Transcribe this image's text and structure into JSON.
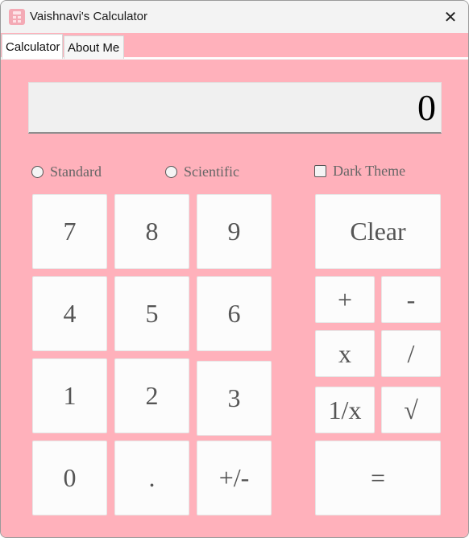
{
  "window": {
    "title": "Vaishnavi's Calculator",
    "close_glyph": "✕"
  },
  "tabs": [
    {
      "label": "Calculator",
      "active": true
    },
    {
      "label": "About Me",
      "active": false
    }
  ],
  "display": {
    "value": "0"
  },
  "options": {
    "standard_label": "Standard",
    "scientific_label": "Scientific",
    "dark_theme_label": "Dark Theme",
    "standard_selected": false,
    "scientific_selected": false,
    "dark_theme_checked": false
  },
  "keys": {
    "seven": "7",
    "eight": "8",
    "nine": "9",
    "four": "4",
    "five": "5",
    "six": "6",
    "one": "1",
    "two": "2",
    "three": "3",
    "zero": "0",
    "decimal": ".",
    "negate": "+/-",
    "clear": "Clear",
    "add": "+",
    "subtract": "-",
    "multiply": "x",
    "divide": "/",
    "reciprocal": "1/x",
    "sqrt": "√",
    "equals": "="
  },
  "colors": {
    "background": "#ffb1bb",
    "button": "#fcfcfc",
    "display": "#f0f0f0"
  }
}
